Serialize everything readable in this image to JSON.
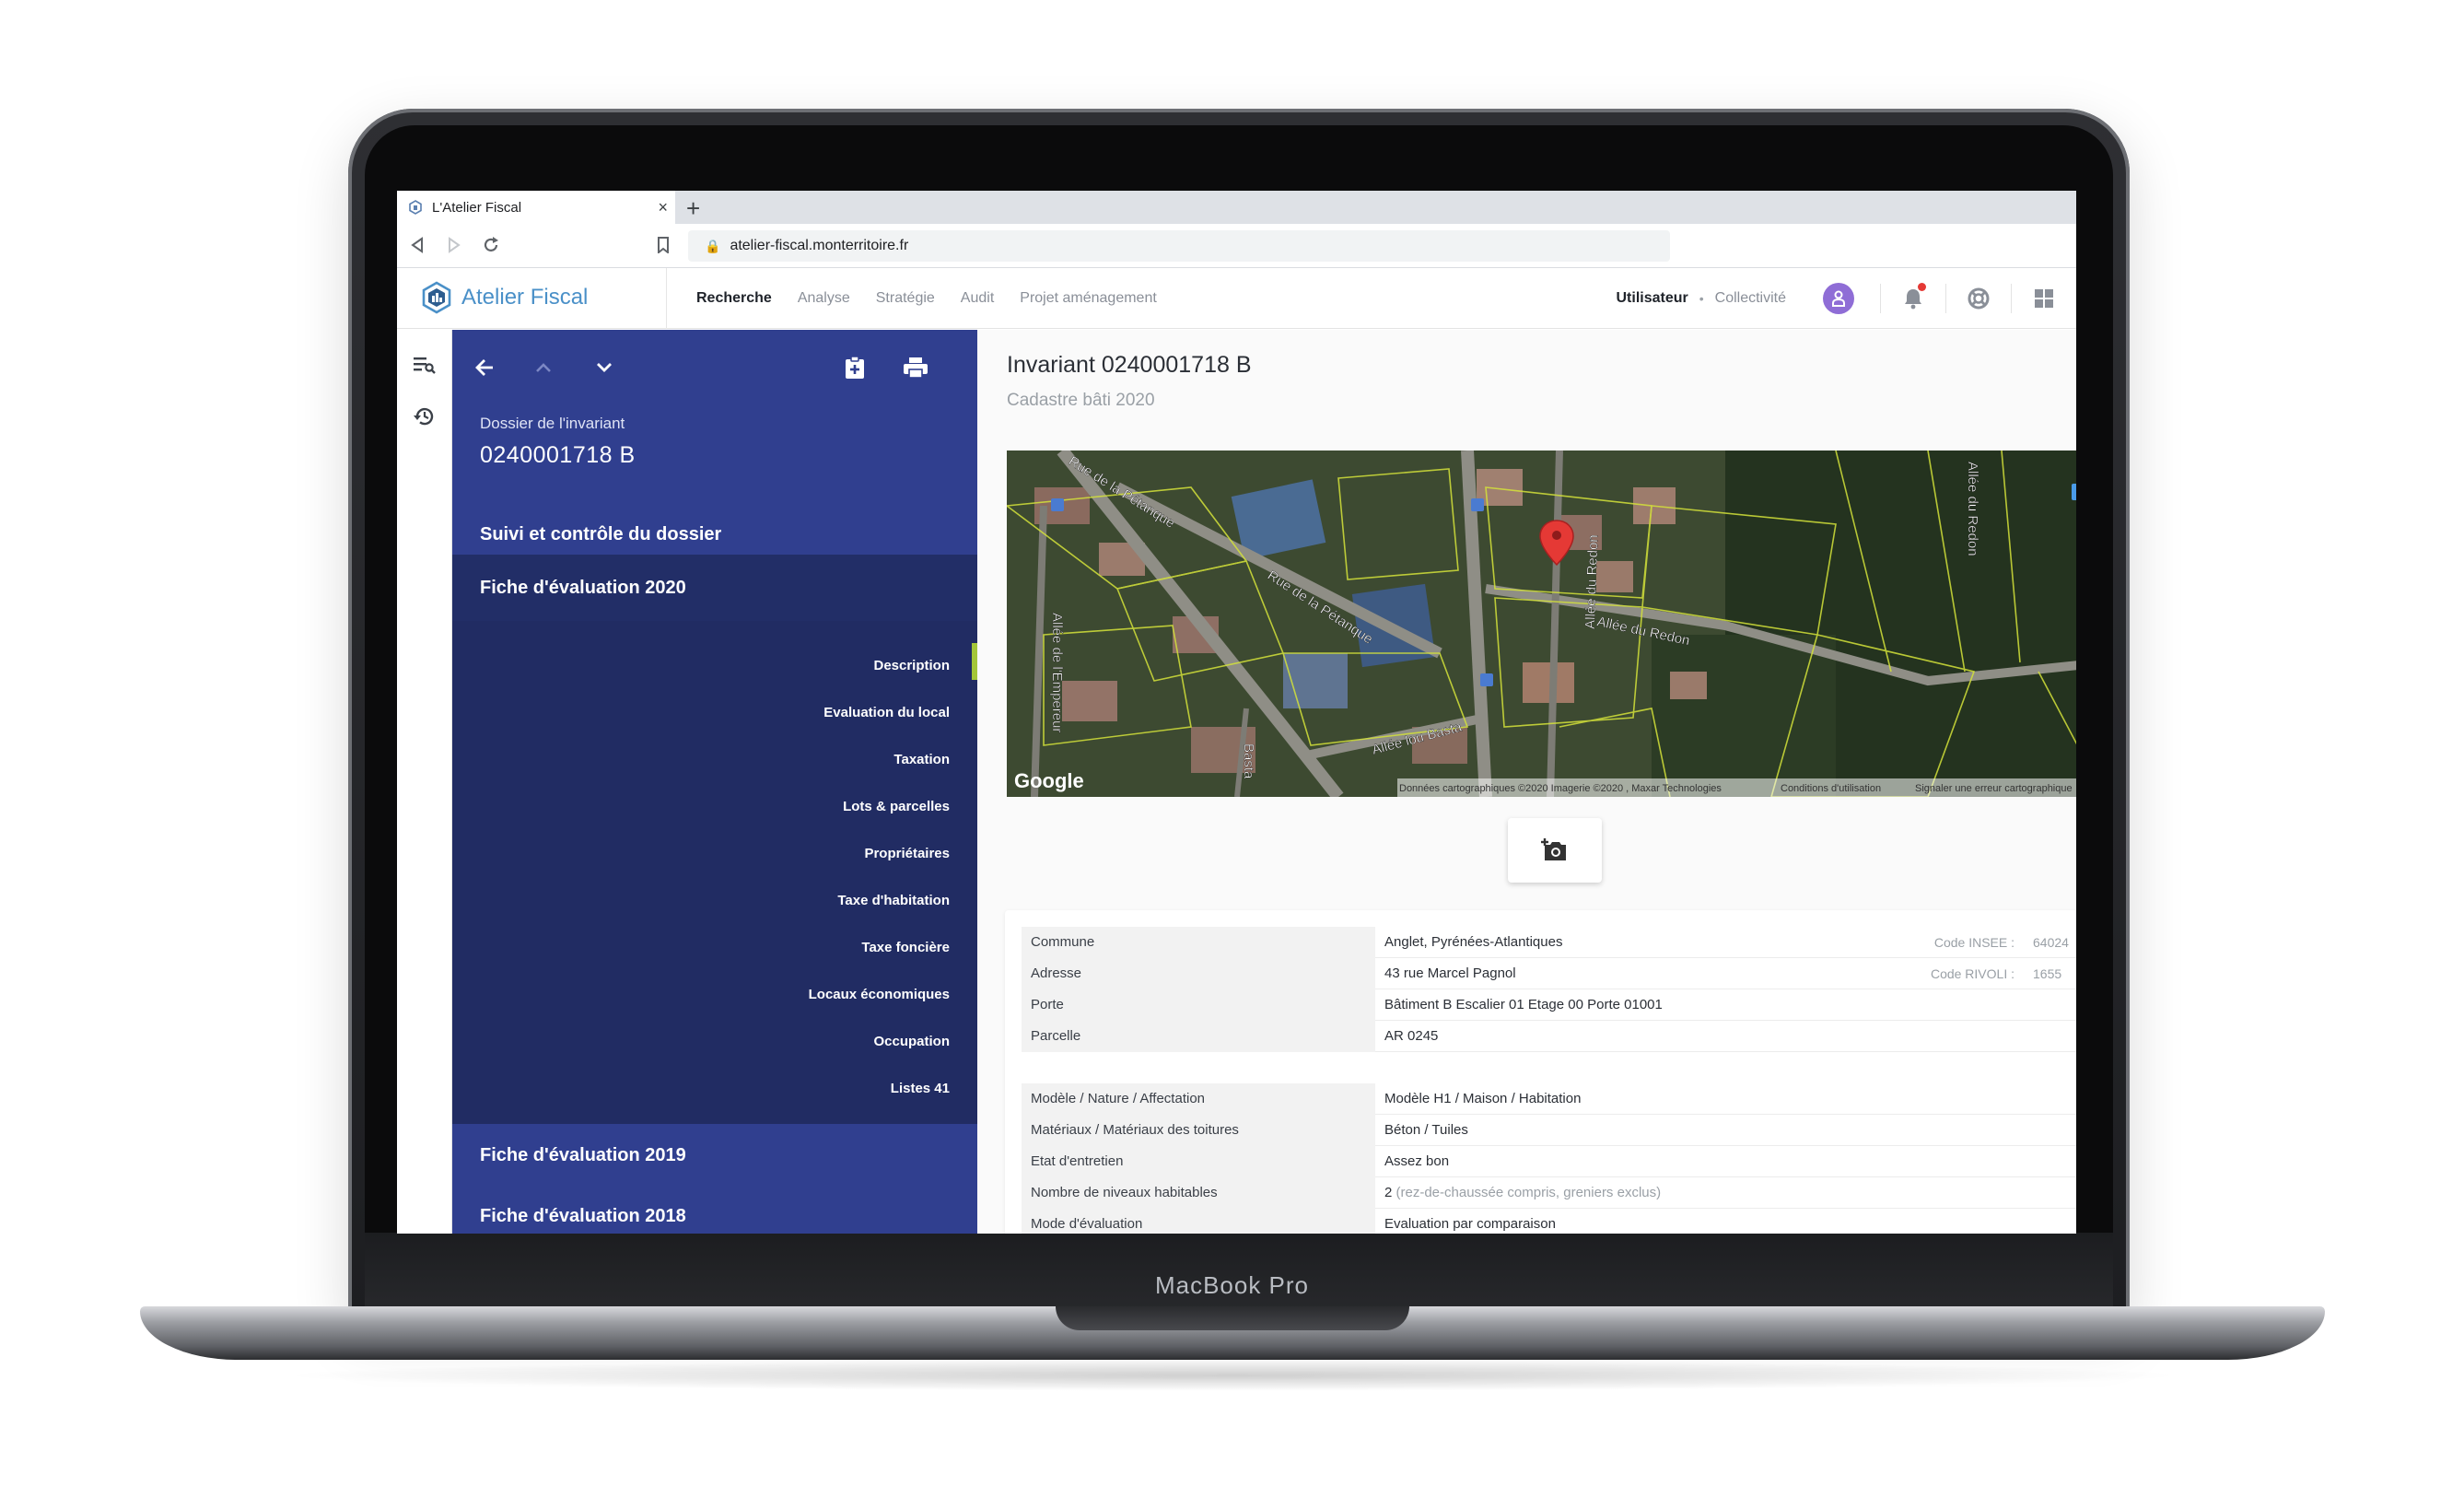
{
  "laptop": {
    "brand": "MacBook Pro"
  },
  "browser": {
    "tab_title": "L'Atelier Fiscal",
    "tab_close": "×",
    "new_tab": "+",
    "url": "atelier-fiscal.monterritoire.fr"
  },
  "app": {
    "logo_text": "Atelier Fiscal",
    "nav": [
      {
        "label": "Recherche",
        "active": true
      },
      {
        "label": "Analyse",
        "active": false
      },
      {
        "label": "Stratégie",
        "active": false
      },
      {
        "label": "Audit",
        "active": false
      },
      {
        "label": "Projet aménagement",
        "active": false
      }
    ],
    "user_label": "Utilisateur",
    "separator": "•",
    "collectivite_label": "Collectivité",
    "accent_color": "#303f8f",
    "active_marker_color": "#a4c639"
  },
  "sidebar": {
    "dossier_label": "Dossier de l'invariant",
    "dossier_number": "0240001718 B",
    "sections": {
      "suivi": "Suivi et contrôle du dossier",
      "fiche_2020": "Fiche d'évaluation 2020",
      "fiche_2019": "Fiche d'évaluation 2019",
      "fiche_2018": "Fiche d'évaluation 2018"
    },
    "items": [
      "Description",
      "Evaluation du local",
      "Taxation",
      "Lots & parcelles",
      "Propriétaires",
      "Taxe d'habitation",
      "Taxe foncière",
      "Locaux économiques",
      "Occupation",
      "Listes 41"
    ]
  },
  "content": {
    "title": "Invariant 0240001718 B",
    "subtitle": "Cadastre bâti 2020",
    "map": {
      "streets": [
        "Rue de la Pétanque",
        "Rue de la Pétanque",
        "Allée du Redon",
        "Allée du Redon",
        "Allée du Redon",
        "Allée de l'Empereur",
        "Allée lou Basta",
        "Basta"
      ],
      "google": "Google",
      "attribution": "Données cartographiques ©2020 Imagerie ©2020 , Maxar Technologies",
      "terms": "Conditions d'utilisation",
      "report": "Signaler une erreur cartographique",
      "marker_color": "#e53935"
    },
    "table1": [
      {
        "k": "Commune",
        "v": "Anglet, Pyrénées-Atlantiques",
        "xk": "Code INSEE :",
        "xv": "64024"
      },
      {
        "k": "Adresse",
        "v": "43 rue Marcel Pagnol",
        "xk": "Code RIVOLI :",
        "xv": "1655"
      },
      {
        "k": "Porte",
        "v": "Bâtiment B Escalier 01 Etage 00 Porte 01001"
      },
      {
        "k": "Parcelle",
        "v": "AR 0245"
      }
    ],
    "table2": [
      {
        "k": "Modèle / Nature / Affectation",
        "v": "Modèle H1 / Maison / Habitation"
      },
      {
        "k": "Matériaux / Matériaux des toitures",
        "v": "Béton / Tuiles"
      },
      {
        "k": "Etat d'entretien",
        "v": "Assez bon"
      },
      {
        "k": "Nombre de niveaux habitables",
        "v": "2",
        "note": "(rez-de-chaussée compris, greniers exclus)"
      },
      {
        "k": "Mode d'évaluation",
        "v": "Evaluation par comparaison"
      }
    ]
  }
}
